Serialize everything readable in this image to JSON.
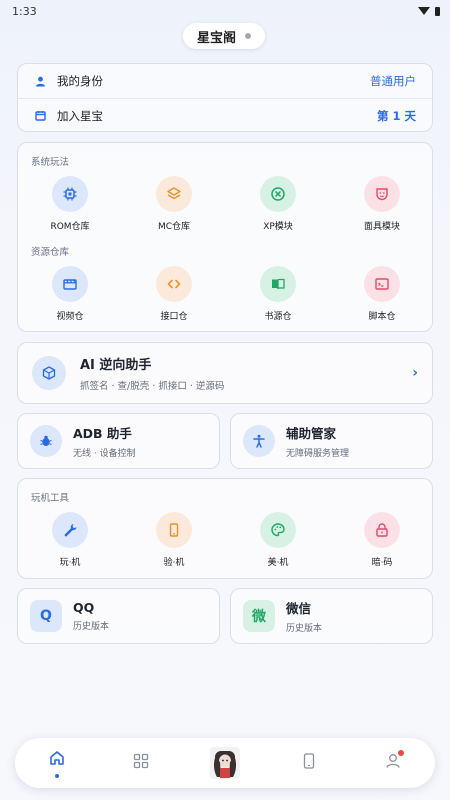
{
  "status_bar": {
    "time": "1:33"
  },
  "app_title": "星宝阁",
  "identity": {
    "rows": [
      {
        "label": "我的身份",
        "value": "普通用户",
        "icon": "person-icon"
      },
      {
        "label": "加入星宝",
        "value": "第 1 天",
        "icon": "calendar-icon"
      }
    ]
  },
  "system_play": {
    "title": "系统玩法",
    "items": [
      {
        "label": "ROM仓库",
        "icon": "chip-icon",
        "color": "#2a6be4"
      },
      {
        "label": "MC仓库",
        "icon": "layers-icon",
        "color": "#e8922f"
      },
      {
        "label": "XP模块",
        "icon": "x-circle-icon",
        "color": "#1fa865"
      },
      {
        "label": "面具模块",
        "icon": "mask-icon",
        "color": "#e4486a"
      }
    ]
  },
  "resource_repo": {
    "title": "资源仓库",
    "items": [
      {
        "label": "视频仓",
        "icon": "clapperboard-icon",
        "color": "#2a6be4"
      },
      {
        "label": "接口仓",
        "icon": "code-icon",
        "color": "#e8922f"
      },
      {
        "label": "书源仓",
        "icon": "book-icon",
        "color": "#1fa865"
      },
      {
        "label": "脚本仓",
        "icon": "terminal-icon",
        "color": "#e4486a"
      }
    ]
  },
  "ai_assistant": {
    "title": "AI 逆向助手",
    "subtitle": "抓签名 · 查/脱壳 · 抓接口 · 逆源码"
  },
  "adb": {
    "title": "ADB 助手",
    "subtitle": "无线 · 设备控制"
  },
  "accessibility": {
    "title": "辅助管家",
    "subtitle": "无障碍服务管理"
  },
  "tools": {
    "title": "玩机工具",
    "items": [
      {
        "label": "玩·机",
        "icon": "wrench-icon",
        "color": "#2a6be4"
      },
      {
        "label": "验·机",
        "icon": "phone-icon",
        "color": "#e8922f"
      },
      {
        "label": "美·机",
        "icon": "palette-icon",
        "color": "#1fa865"
      },
      {
        "label": "暗·码",
        "icon": "lock-icon",
        "color": "#e4486a"
      }
    ]
  },
  "qq": {
    "badge": "Q",
    "title": "QQ",
    "subtitle": "历史版本"
  },
  "wechat": {
    "badge": "微",
    "title": "微信",
    "subtitle": "历史版本"
  },
  "colors": {
    "accent": "#2a6be4",
    "badge": "#e84a3f"
  }
}
